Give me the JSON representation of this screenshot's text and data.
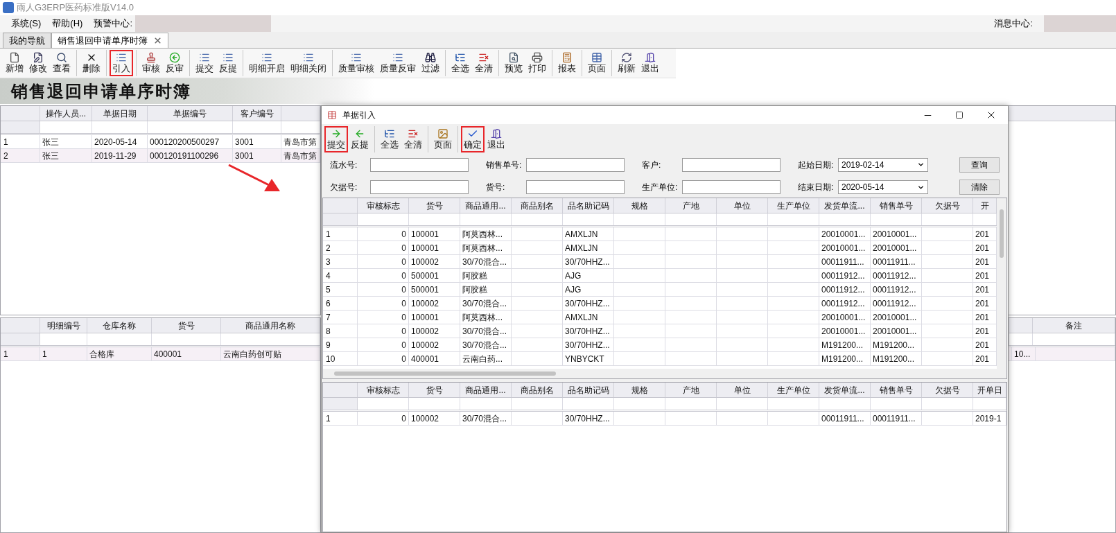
{
  "window": {
    "title": "雨人G3ERP医药标准版V14.0"
  },
  "menu": {
    "items": [
      "系统(S)",
      "帮助(H)"
    ],
    "alert_label": "预警中心:",
    "message_label": "消息中心:"
  },
  "tabs": [
    {
      "label": "我的导航",
      "selected": false
    },
    {
      "label": "销售退回申请单序时簿",
      "selected": true
    }
  ],
  "toolbar": {
    "groups": [
      [
        {
          "label": "新增",
          "highlighted": false
        },
        {
          "label": "修改",
          "highlighted": false
        },
        {
          "label": "查看",
          "highlighted": false
        }
      ],
      [
        {
          "label": "删除",
          "highlighted": false
        }
      ],
      [
        {
          "label": "引入",
          "highlighted": true
        }
      ],
      [
        {
          "label": "审核",
          "highlighted": false
        },
        {
          "label": "反审",
          "highlighted": false
        }
      ],
      [
        {
          "label": "提交",
          "highlighted": false
        },
        {
          "label": "反提",
          "highlighted": false
        }
      ],
      [
        {
          "label": "明细开启",
          "highlighted": false
        },
        {
          "label": "明细关闭",
          "highlighted": false
        }
      ],
      [
        {
          "label": "质量审核",
          "highlighted": false
        },
        {
          "label": "质量反审",
          "highlighted": false
        },
        {
          "label": "过滤",
          "highlighted": false
        }
      ],
      [
        {
          "label": "全选",
          "highlighted": false
        },
        {
          "label": "全清",
          "highlighted": false
        }
      ],
      [
        {
          "label": "预览",
          "highlighted": false
        },
        {
          "label": "打印",
          "highlighted": false
        }
      ],
      [
        {
          "label": "报表",
          "highlighted": false
        }
      ],
      [
        {
          "label": "页面",
          "highlighted": false
        }
      ],
      [
        {
          "label": "刷新",
          "highlighted": false
        },
        {
          "label": "退出",
          "highlighted": false
        }
      ]
    ]
  },
  "banner": {
    "title": "销售退回申请单序时簿"
  },
  "master_grid": {
    "columns": [
      {
        "label": "操作人员..."
      },
      {
        "label": "单据日期"
      },
      {
        "label": "单据编号"
      },
      {
        "label": "客户编号"
      },
      {}
    ],
    "rows": [
      {
        "number": "1",
        "selected": false,
        "cells": [
          "张三",
          "2020-05-14",
          "000120200500297",
          "3001",
          "青岛市第"
        ]
      },
      {
        "number": "2",
        "selected": true,
        "cells": [
          "张三",
          "2019-11-29",
          "000120191100296",
          "3001",
          "青岛市第"
        ]
      }
    ]
  },
  "detail_grid": {
    "columns": [
      {
        "label": "明细编号"
      },
      {
        "label": "仓库名称"
      },
      {
        "label": "货号"
      },
      {
        "label": "商品通用名称"
      }
    ],
    "rows": [
      {
        "number": "1",
        "selected": true,
        "cells": [
          "1",
          "合格库",
          "400001",
          "云南白药创可贴"
        ]
      }
    ]
  },
  "detail_grid_right": {
    "columns": [
      {},
      {
        "label": "备注"
      }
    ],
    "rows": [
      {
        "selected": true,
        "cells": [
          "10...",
          null
        ]
      }
    ]
  },
  "dialog": {
    "title": "单据引入",
    "toolbar": {
      "groups": [
        [
          {
            "label": "提交",
            "highlighted": true
          },
          {
            "label": "反提",
            "highlighted": false
          }
        ],
        [
          {
            "label": "全选",
            "highlighted": false
          },
          {
            "label": "全清",
            "highlighted": false
          }
        ],
        [
          {
            "label": "页面",
            "highlighted": false
          }
        ],
        [
          {
            "label": "确定",
            "highlighted": true
          },
          {
            "label": "退出",
            "highlighted": false
          }
        ]
      ]
    },
    "filters": [
      {
        "label": "流水号:",
        "kind": "text"
      },
      {
        "label": "销售单号:",
        "kind": "text"
      },
      {
        "label": "客户:",
        "kind": "text"
      },
      {
        "label": "起始日期:",
        "kind": "date",
        "value": "2019-02-14"
      },
      {
        "label": "欠据号:",
        "kind": "text"
      },
      {
        "label": "货号:",
        "kind": "text"
      },
      {
        "label": "生产单位:",
        "kind": "text"
      },
      {
        "label": "结束日期:",
        "kind": "date",
        "value": "2020-05-14"
      }
    ],
    "buttons": [
      "查询",
      "清除"
    ],
    "source_grid": {
      "columns": [
        {
          "label": "审核标志"
        },
        {
          "label": "货号"
        },
        {
          "label": "商品通用..."
        },
        {
          "label": "商品别名"
        },
        {
          "label": "品名助记码"
        },
        {
          "label": "规格"
        },
        {
          "label": "产地"
        },
        {
          "label": "单位"
        },
        {
          "label": "生产单位"
        },
        {
          "label": "发货单流..."
        },
        {
          "label": "销售单号"
        },
        {
          "label": "欠据号"
        },
        {
          "label": "开"
        }
      ],
      "rows": [
        {
          "number": "1",
          "cells": [
            "0",
            "100001",
            "阿莫西林...",
            null,
            "AMXLJN",
            null,
            null,
            null,
            null,
            "20010001...",
            "20010001...",
            null,
            "201"
          ]
        },
        {
          "number": "2",
          "cells": [
            "0",
            "100001",
            "阿莫西林...",
            null,
            "AMXLJN",
            null,
            null,
            null,
            null,
            "20010001...",
            "20010001...",
            null,
            "201"
          ]
        },
        {
          "number": "3",
          "cells": [
            "0",
            "100002",
            "30/70混合...",
            null,
            "30/70HHZ...",
            null,
            null,
            null,
            null,
            "00011911...",
            "00011911...",
            null,
            "201"
          ]
        },
        {
          "number": "4",
          "cells": [
            "0",
            "500001",
            "阿胶糕",
            null,
            "AJG",
            null,
            null,
            null,
            null,
            "00011912...",
            "00011912...",
            null,
            "201"
          ]
        },
        {
          "number": "5",
          "cells": [
            "0",
            "500001",
            "阿胶糕",
            null,
            "AJG",
            null,
            null,
            null,
            null,
            "00011912...",
            "00011912...",
            null,
            "201"
          ]
        },
        {
          "number": "6",
          "cells": [
            "0",
            "100002",
            "30/70混合...",
            null,
            "30/70HHZ...",
            null,
            null,
            null,
            null,
            "00011912...",
            "00011912...",
            null,
            "201"
          ]
        },
        {
          "number": "7",
          "cells": [
            "0",
            "100001",
            "阿莫西林...",
            null,
            "AMXLJN",
            null,
            null,
            null,
            null,
            "20010001...",
            "20010001...",
            null,
            "201"
          ]
        },
        {
          "number": "8",
          "cells": [
            "0",
            "100002",
            "30/70混合...",
            null,
            "30/70HHZ...",
            null,
            null,
            null,
            null,
            "20010001...",
            "20010001...",
            null,
            "201"
          ]
        },
        {
          "number": "9",
          "cells": [
            "0",
            "100002",
            "30/70混合...",
            null,
            "30/70HHZ...",
            null,
            null,
            null,
            null,
            "M191200...",
            "M191200...",
            null,
            "201"
          ]
        },
        {
          "number": "10",
          "cells": [
            "0",
            "400001",
            "云南白药...",
            null,
            "YNBYCKT",
            null,
            null,
            null,
            null,
            "M191200...",
            "M191200...",
            null,
            "201"
          ]
        }
      ]
    },
    "selected_grid": {
      "columns": [
        {
          "label": "审核标志"
        },
        {
          "label": "货号"
        },
        {
          "label": "商品通用..."
        },
        {
          "label": "商品别名"
        },
        {
          "label": "品名助记码"
        },
        {
          "label": "规格"
        },
        {
          "label": "产地"
        },
        {
          "label": "单位"
        },
        {
          "label": "生产单位"
        },
        {
          "label": "发货单流..."
        },
        {
          "label": "销售单号"
        },
        {
          "label": "欠据号"
        },
        {
          "label": "开单日"
        }
      ],
      "rows": [
        {
          "number": "1",
          "cells": [
            "0",
            "100002",
            "30/70混合...",
            null,
            "30/70HHZ...",
            null,
            null,
            null,
            null,
            "00011911...",
            "00011911...",
            null,
            "2019-1"
          ]
        }
      ]
    }
  }
}
